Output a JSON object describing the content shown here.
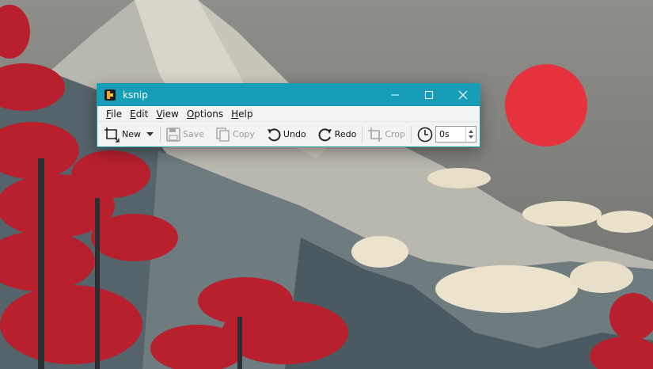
{
  "window": {
    "title": "ksnip",
    "accent": "#169eb9"
  },
  "menu": {
    "items": [
      {
        "mnemonic": "F",
        "rest": "ile"
      },
      {
        "mnemonic": "E",
        "rest": "dit"
      },
      {
        "mnemonic": "V",
        "rest": "iew"
      },
      {
        "mnemonic": "O",
        "rest": "ptions"
      },
      {
        "mnemonic": "H",
        "rest": "elp"
      }
    ]
  },
  "toolbar": {
    "new_label": "New",
    "save_label": "Save",
    "copy_label": "Copy",
    "undo_label": "Undo",
    "redo_label": "Redo",
    "crop_label": "Crop",
    "delay_value": "0s"
  },
  "icons": {
    "app": "ksnip-logo-icon",
    "new": "rect-select-icon",
    "save": "floppy-disk-icon",
    "copy": "copy-icon",
    "undo": "undo-arrow-icon",
    "redo": "redo-arrow-icon",
    "crop": "crop-icon",
    "delay": "clock-icon"
  },
  "colors": {
    "sun": "#e5323c",
    "foliage": "#b8202e"
  }
}
